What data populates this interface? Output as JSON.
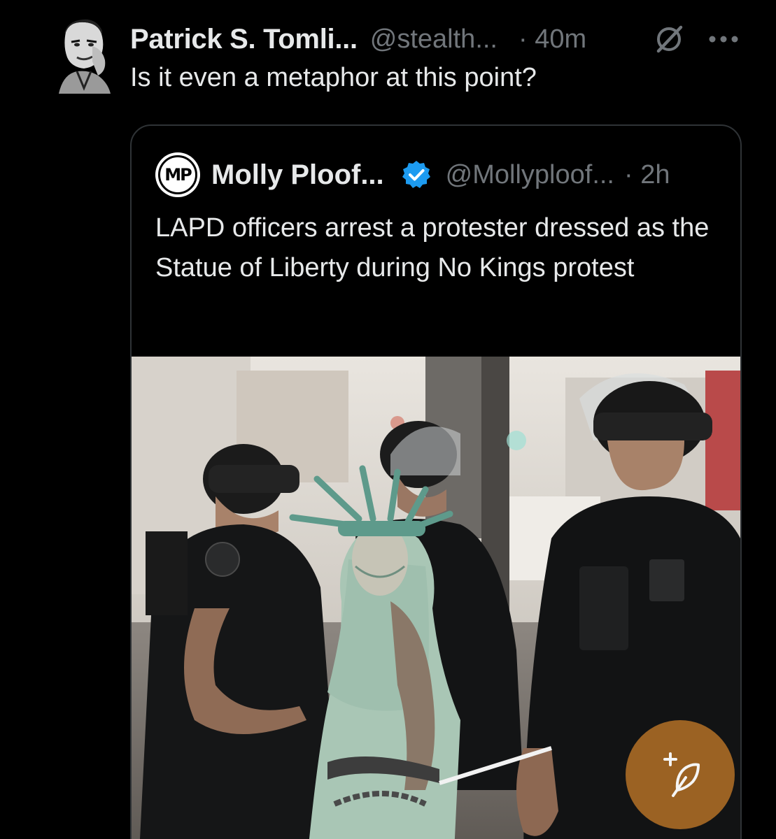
{
  "post": {
    "author_name": "Patrick S. Tomli...",
    "author_handle": "@stealth...",
    "timestamp": "· 40m",
    "text": "Is it even a metaphor at this point?",
    "icons": [
      "grok-icon",
      "more-options-icon"
    ]
  },
  "quoted_post": {
    "avatar_initials": "MP",
    "author_name": "Molly Ploof...",
    "verified": true,
    "author_handle": "@Mollyploof...",
    "timestamp": "· 2h",
    "text": "LAPD officers arrest a protester dressed as the Statue of Liberty during No Kings protest",
    "media": {
      "type": "photo",
      "subject": "statue-of-liberty-protester-with-officers"
    }
  },
  "compose_button": {
    "icon": "compose-feather-icon"
  },
  "colors": {
    "background": "#000000",
    "primary_text": "#e7e9ea",
    "secondary_text": "#71767b",
    "border": "#2f3336",
    "verified_blue": "#1d9bf0",
    "compose_orange": "#c27828"
  }
}
